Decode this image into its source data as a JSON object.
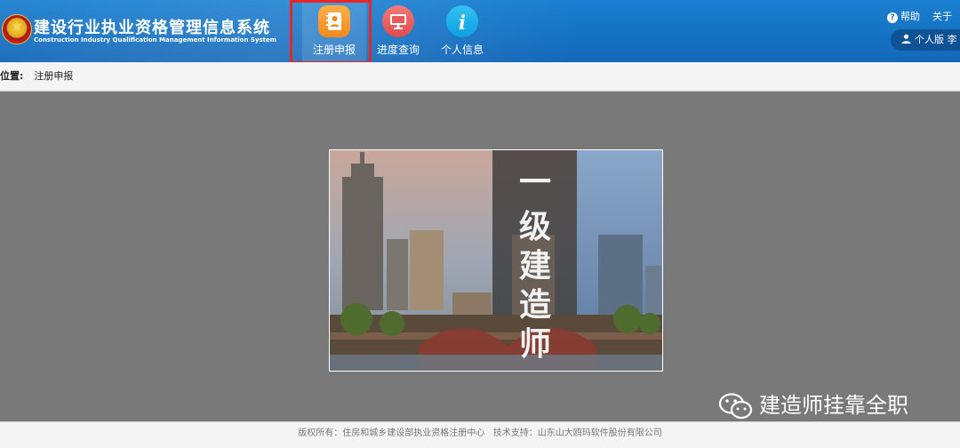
{
  "header": {
    "title": "建设行业执业资格管理信息系统",
    "subtitle": "Construction Industry Qualification Management Information System",
    "nav": [
      {
        "label": "注册申报",
        "icon": "address-book-icon",
        "color": "#f59a2c"
      },
      {
        "label": "进度查询",
        "icon": "monitor-icon",
        "color": "#e85a5a"
      },
      {
        "label": "个人信息",
        "icon": "info-icon",
        "color": "#1fb0ee"
      }
    ],
    "help_label": "帮助",
    "about_label": "关于",
    "user_label": "个人版 李"
  },
  "breadcrumb": {
    "key": "位置:",
    "value": "注册申报"
  },
  "banner": {
    "text": [
      "一",
      "级",
      "建",
      "造",
      "师"
    ]
  },
  "watermark": "建造师挂靠全职",
  "footer": {
    "copyright": "版权所有：住房和城乡建设部执业资格注册中心",
    "support": "技术支持：山东山大鸥玛软件股份有限公司"
  },
  "colors": {
    "header_blue": "#1670c0",
    "highlight_red": "#e8262a"
  }
}
